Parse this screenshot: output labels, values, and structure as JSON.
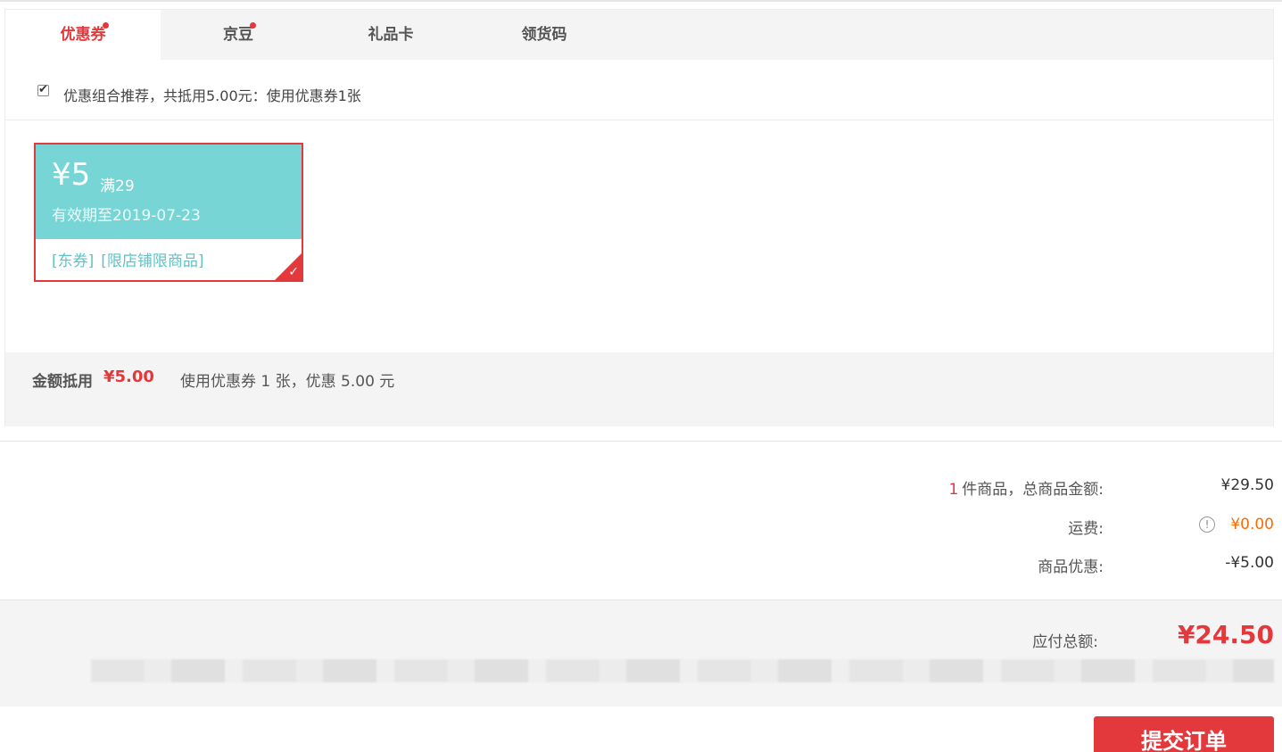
{
  "tabs": [
    {
      "label": "优惠券",
      "active": true,
      "dot": true
    },
    {
      "label": "京豆",
      "active": false,
      "dot": true
    },
    {
      "label": "礼品卡",
      "active": false,
      "dot": false
    },
    {
      "label": "领货码",
      "active": false,
      "dot": false
    }
  ],
  "combo": {
    "checked": true,
    "text": "优惠组合推荐，共抵用5.00元：使用优惠券1张"
  },
  "coupon": {
    "amount": "¥5",
    "condition": "满29",
    "validity": "有效期至2019-07-23",
    "tag1": "[东券]",
    "tag2": "[限店铺限商品]",
    "selected": true
  },
  "summary": {
    "label": "金额抵用",
    "amount": "¥5.00",
    "desc": "使用优惠券 1 张，优惠 5.00 元"
  },
  "prices": {
    "count": "1",
    "goods_label": "件商品，总商品金额:",
    "goods_value": "¥29.50",
    "freight_label": "运费:",
    "freight_value": "¥0.00",
    "discount_label": "商品优惠:",
    "discount_value": "-¥5.00"
  },
  "total": {
    "label": "应付总额:",
    "value": "¥24.50"
  },
  "submit_label": "提交订单",
  "colors": {
    "accent": "#e4393c",
    "coupon_bg": "#78d5d6",
    "freight": "#ff6a00",
    "panel_bg": "#f4f4f4"
  }
}
